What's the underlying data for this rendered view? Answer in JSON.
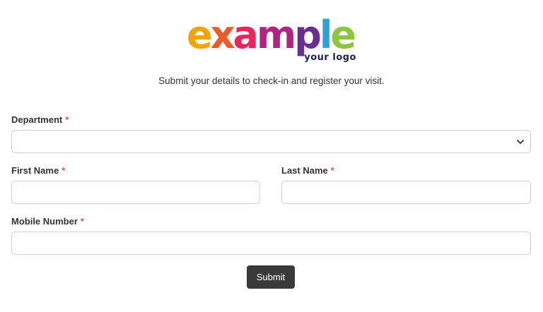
{
  "logo": {
    "word": "example",
    "letters": [
      {
        "ch": "e",
        "color": "#f6a200"
      },
      {
        "ch": "x",
        "color": "#f15a24"
      },
      {
        "ch": "a",
        "color": "#e8265a"
      },
      {
        "ch": "m",
        "color": "#b0237f"
      },
      {
        "ch": "p",
        "color": "#6a2d91"
      },
      {
        "ch": "l",
        "color": "#2aa4d8"
      },
      {
        "ch": "e",
        "color": "#8cc63f"
      }
    ],
    "tagline": "your logo"
  },
  "intro": "Submit your details to check-in and register your visit.",
  "form": {
    "required_mark": "*",
    "department": {
      "label": "Department",
      "value": ""
    },
    "first_name": {
      "label": "First Name",
      "value": ""
    },
    "last_name": {
      "label": "Last Name",
      "value": ""
    },
    "mobile": {
      "label": "Mobile Number",
      "value": ""
    },
    "submit_label": "Submit"
  },
  "colors": {
    "required": "#d9534f",
    "button": "#3a3a3a",
    "border": "#cfcfcf"
  }
}
